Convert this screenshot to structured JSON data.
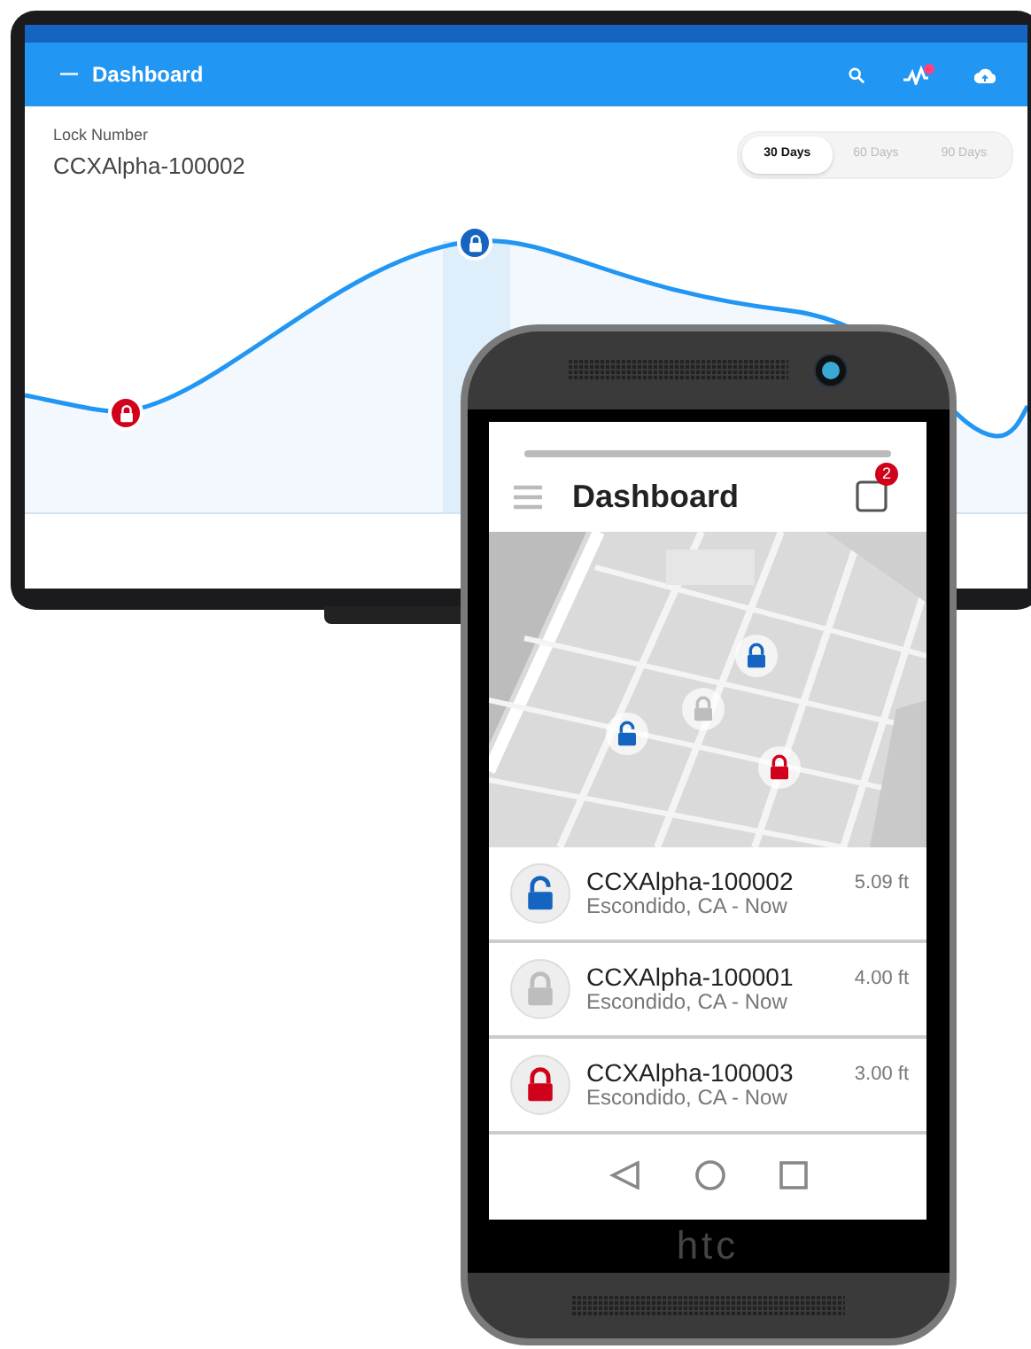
{
  "monitor": {
    "app_bar": {
      "title": "Dashboard",
      "activity_alert": true
    },
    "lock_label": "Lock Number",
    "lock_number": "CCXAlpha-100002",
    "range_tabs": [
      {
        "label": "30 Days",
        "selected": true
      },
      {
        "label": "60 Days",
        "selected": false
      },
      {
        "label": "90 Days",
        "selected": false
      }
    ],
    "chart_markers": [
      {
        "color": "#d0021b",
        "locked": true
      },
      {
        "color": "#1565c0",
        "locked": true
      }
    ]
  },
  "phone": {
    "title": "Dashboard",
    "notification_count": "2",
    "map_markers": [
      {
        "color": "#1565c0",
        "locked": true
      },
      {
        "color": "#bdbdbd",
        "locked": true
      },
      {
        "color": "#1565c0",
        "locked": false
      },
      {
        "color": "#d0021b",
        "locked": true
      }
    ],
    "locks": [
      {
        "name": "CCXAlpha-100002",
        "location": "Escondido, CA - Now",
        "distance": "5.09 ft",
        "color": "#1565c0",
        "locked": false
      },
      {
        "name": "CCXAlpha-100001",
        "location": "Escondido, CA - Now",
        "distance": "4.00 ft",
        "color": "#bdbdbd",
        "locked": true
      },
      {
        "name": "CCXAlpha-100003",
        "location": "Escondido, CA - Now",
        "distance": "3.00 ft",
        "color": "#d0021b",
        "locked": true
      }
    ],
    "brand": "htc"
  }
}
